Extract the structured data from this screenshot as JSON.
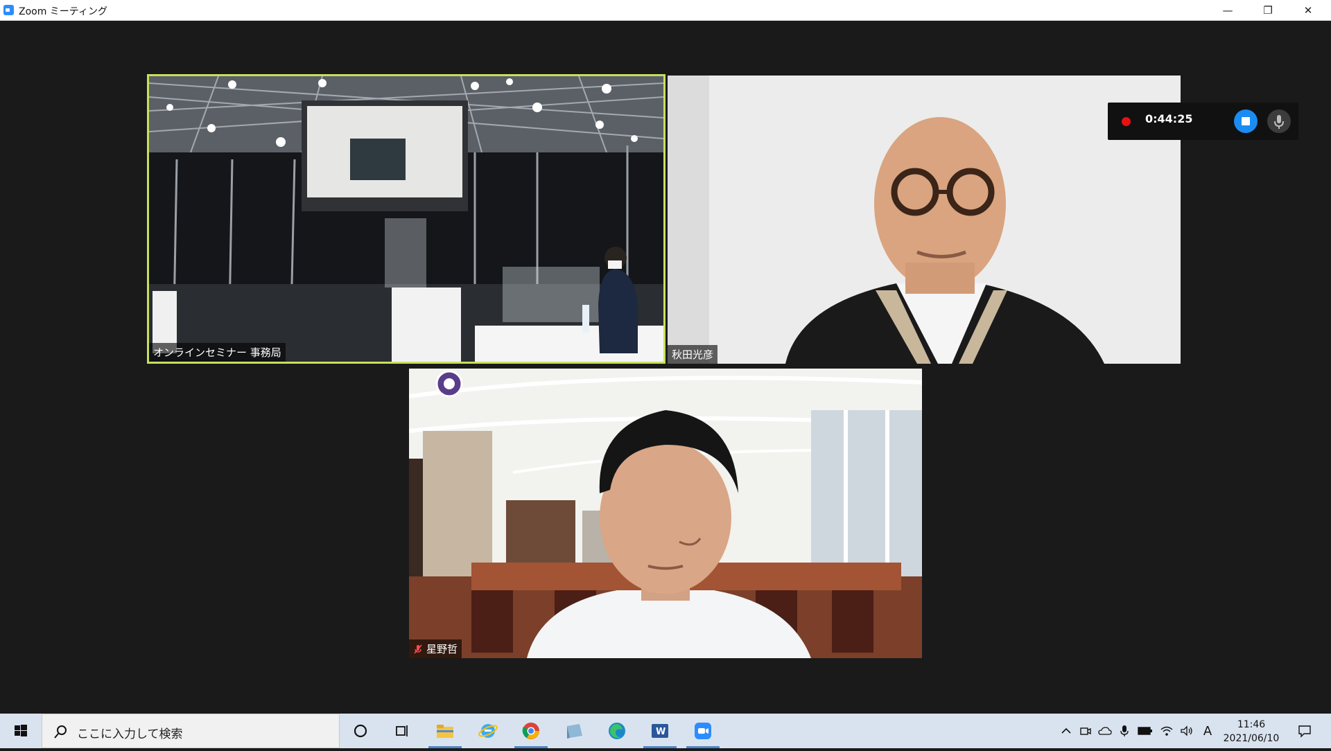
{
  "window": {
    "title": "Zoom ミーティング",
    "controls": {
      "minimize": "—",
      "restore": "❐",
      "close": "✕"
    }
  },
  "participants": [
    {
      "name": "オンラインセミナー 事務局",
      "active_speaker": true,
      "muted": false
    },
    {
      "name": "秋田光彦",
      "active_speaker": false,
      "muted": false
    },
    {
      "name": "星野哲",
      "active_speaker": false,
      "muted": true
    }
  ],
  "recording": {
    "elapsed": "0:44:25",
    "status_color": "#e81111",
    "stop_color": "#1b8cf2"
  },
  "taskbar": {
    "search_placeholder": "ここに入力して検索",
    "ime_indicator": "A",
    "time": "11:46",
    "date": "2021/06/10",
    "pinned": [
      "cortana-icon",
      "task-view-icon",
      "file-explorer-icon",
      "internet-explorer-icon",
      "chrome-icon",
      "app-icon",
      "edge-icon",
      "word-icon",
      "zoom-icon"
    ]
  },
  "colors": {
    "active_speaker_border": "#c7e05b",
    "stage_background": "#1a1a1a",
    "taskbar": "#d9e3ef"
  }
}
